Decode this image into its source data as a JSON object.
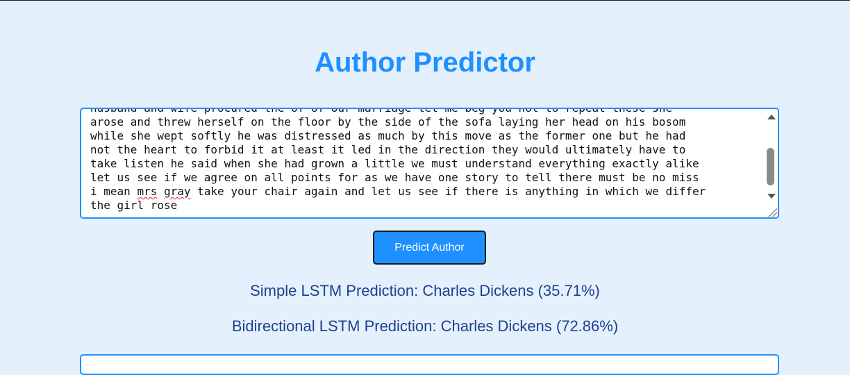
{
  "app": {
    "title": "Author Predictor"
  },
  "text_input": {
    "lines": [
      "husband and wife procured the of of our marriage let me beg you not to repeat these she",
      "arose and threw herself on the floor by the side of the sofa laying her head on his bosom",
      "while she wept softly he was distressed as much by this move as the former one but he had",
      "not the heart to forbid it at least it led in the direction they would ultimately have to",
      "take listen he said when she had grown a little we must understand everything exactly alike",
      "let us see if we agree on all points for as we have one story to tell there must be no miss"
    ],
    "line7_before": "i mean ",
    "line7_misspelled_1": "mrs",
    "line7_space": " ",
    "line7_misspelled_2": "gray",
    "line7_after": " take your chair again and let us see if there is anything in which we differ",
    "line8": "the girl rose"
  },
  "predict_button": {
    "label": "Predict Author"
  },
  "results": {
    "simple_lstm": "Simple LSTM Prediction: Charles Dickens (35.71%)",
    "bidirectional_lstm": "Bidirectional LSTM Prediction: Charles Dickens (72.86%)"
  },
  "colors": {
    "background": "#e4f0fb",
    "accent": "#1e90ff",
    "result_text": "#1f3f8f"
  }
}
